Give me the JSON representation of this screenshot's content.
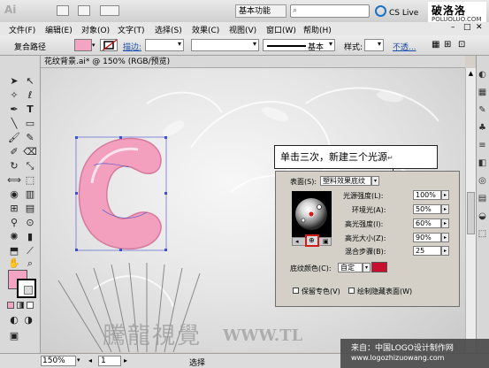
{
  "app": {
    "logo": "Ai",
    "workspace": "基本功能",
    "cs_live": "CS Live",
    "brand_cn": "破洛洛",
    "brand_url": "POLUOLUO.COM"
  },
  "menu": [
    "文件(F)",
    "编辑(E)",
    "对象(O)",
    "文字(T)",
    "选择(S)",
    "效果(C)",
    "视图(V)",
    "窗口(W)",
    "帮助(H)"
  ],
  "control_bar": {
    "selection_type": "复合路径",
    "stroke_label": "描边:",
    "style_label": "样式:",
    "brush_label": "基本",
    "opacity_label": "不透...",
    "fill_color": "#f4a4c3"
  },
  "document": {
    "tab_title": "花纹背景.ai* @ 150% (RGB/预览)",
    "zoom": "150%",
    "page": "1",
    "status": "选择",
    "watermark_cn": "騰龍視覺",
    "watermark_url": "WWW.TL"
  },
  "callout": {
    "text": "单击三次，新建三个光源"
  },
  "shading_panel": {
    "surface_label": "表面(S):",
    "surface_value": "塑料效果底纹",
    "fields": [
      {
        "label": "光源强度(L):",
        "value": "100%"
      },
      {
        "label": "环境光(A):",
        "value": "50%"
      },
      {
        "label": "高光强度(I):",
        "value": "60%"
      },
      {
        "label": "高光大小(Z):",
        "value": "90%"
      },
      {
        "label": "混合步骤(B):",
        "value": "25"
      }
    ],
    "shading_color_label": "底纹颜色(C):",
    "shading_color_value": "自定",
    "shading_color_swatch": "#c8102e",
    "preserve_spot_label": "保留专色(V)",
    "draw_hidden_label": "绘制隐藏表面(W)"
  },
  "source": {
    "line1": "来自：中国LOGO设计制作网",
    "line2": "www.logozhizuowang.com"
  }
}
